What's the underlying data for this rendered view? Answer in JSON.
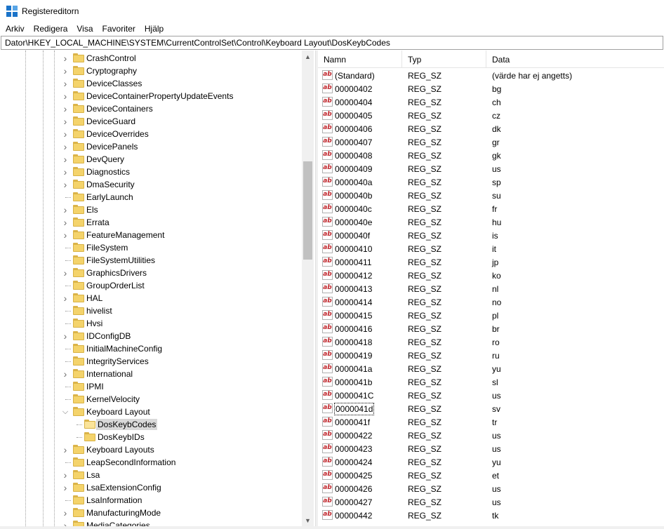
{
  "window": {
    "title": "Registereditorn",
    "app_icon": "registry-editor-icon"
  },
  "menu": [
    "Arkiv",
    "Redigera",
    "Visa",
    "Favoriter",
    "Hjälp"
  ],
  "address": "Dator\\HKEY_LOCAL_MACHINE\\SYSTEM\\CurrentControlSet\\Control\\Keyboard Layout\\DosKeybCodes",
  "tree": {
    "nodes": [
      {
        "label": "CrashControl",
        "expander": "collapsed",
        "level": 0
      },
      {
        "label": "Cryptography",
        "expander": "collapsed",
        "level": 0
      },
      {
        "label": "DeviceClasses",
        "expander": "collapsed",
        "level": 0
      },
      {
        "label": "DeviceContainerPropertyUpdateEvents",
        "expander": "collapsed",
        "level": 0
      },
      {
        "label": "DeviceContainers",
        "expander": "collapsed",
        "level": 0
      },
      {
        "label": "DeviceGuard",
        "expander": "collapsed",
        "level": 0
      },
      {
        "label": "DeviceOverrides",
        "expander": "collapsed",
        "level": 0
      },
      {
        "label": "DevicePanels",
        "expander": "collapsed",
        "level": 0
      },
      {
        "label": "DevQuery",
        "expander": "collapsed",
        "level": 0
      },
      {
        "label": "Diagnostics",
        "expander": "collapsed",
        "level": 0
      },
      {
        "label": "DmaSecurity",
        "expander": "collapsed",
        "level": 0
      },
      {
        "label": "EarlyLaunch",
        "expander": "none",
        "level": 0
      },
      {
        "label": "Els",
        "expander": "collapsed",
        "level": 0
      },
      {
        "label": "Errata",
        "expander": "collapsed",
        "level": 0
      },
      {
        "label": "FeatureManagement",
        "expander": "collapsed",
        "level": 0
      },
      {
        "label": "FileSystem",
        "expander": "none",
        "level": 0
      },
      {
        "label": "FileSystemUtilities",
        "expander": "none",
        "level": 0
      },
      {
        "label": "GraphicsDrivers",
        "expander": "collapsed",
        "level": 0
      },
      {
        "label": "GroupOrderList",
        "expander": "none",
        "level": 0
      },
      {
        "label": "HAL",
        "expander": "collapsed",
        "level": 0
      },
      {
        "label": "hivelist",
        "expander": "none",
        "level": 0
      },
      {
        "label": "Hvsi",
        "expander": "none",
        "level": 0
      },
      {
        "label": "IDConfigDB",
        "expander": "collapsed",
        "level": 0
      },
      {
        "label": "InitialMachineConfig",
        "expander": "none",
        "level": 0
      },
      {
        "label": "IntegrityServices",
        "expander": "none",
        "level": 0
      },
      {
        "label": "International",
        "expander": "collapsed",
        "level": 0
      },
      {
        "label": "IPMI",
        "expander": "none",
        "level": 0
      },
      {
        "label": "KernelVelocity",
        "expander": "none",
        "level": 0
      },
      {
        "label": "Keyboard Layout",
        "expander": "expanded",
        "level": 0
      },
      {
        "label": "DosKeybCodes",
        "expander": "none",
        "level": 1,
        "selected": true
      },
      {
        "label": "DosKeybIDs",
        "expander": "none",
        "level": 1
      },
      {
        "label": "Keyboard Layouts",
        "expander": "collapsed",
        "level": 0
      },
      {
        "label": "LeapSecondInformation",
        "expander": "none",
        "level": 0
      },
      {
        "label": "Lsa",
        "expander": "collapsed",
        "level": 0
      },
      {
        "label": "LsaExtensionConfig",
        "expander": "collapsed",
        "level": 0
      },
      {
        "label": "LsaInformation",
        "expander": "none",
        "level": 0
      },
      {
        "label": "ManufacturingMode",
        "expander": "collapsed",
        "level": 0
      },
      {
        "label": "MediaCategories",
        "expander": "collapsed",
        "level": 0
      }
    ]
  },
  "list": {
    "columns": [
      "Namn",
      "Typ",
      "Data"
    ],
    "rows": [
      {
        "name": "(Standard)",
        "type": "REG_SZ",
        "data": "(värde har ej angetts)"
      },
      {
        "name": "00000402",
        "type": "REG_SZ",
        "data": "bg"
      },
      {
        "name": "00000404",
        "type": "REG_SZ",
        "data": "ch"
      },
      {
        "name": "00000405",
        "type": "REG_SZ",
        "data": "cz"
      },
      {
        "name": "00000406",
        "type": "REG_SZ",
        "data": "dk"
      },
      {
        "name": "00000407",
        "type": "REG_SZ",
        "data": "gr"
      },
      {
        "name": "00000408",
        "type": "REG_SZ",
        "data": "gk"
      },
      {
        "name": "00000409",
        "type": "REG_SZ",
        "data": "us"
      },
      {
        "name": "0000040a",
        "type": "REG_SZ",
        "data": "sp"
      },
      {
        "name": "0000040b",
        "type": "REG_SZ",
        "data": "su"
      },
      {
        "name": "0000040c",
        "type": "REG_SZ",
        "data": "fr"
      },
      {
        "name": "0000040e",
        "type": "REG_SZ",
        "data": "hu"
      },
      {
        "name": "0000040f",
        "type": "REG_SZ",
        "data": "is"
      },
      {
        "name": "00000410",
        "type": "REG_SZ",
        "data": "it"
      },
      {
        "name": "00000411",
        "type": "REG_SZ",
        "data": "jp"
      },
      {
        "name": "00000412",
        "type": "REG_SZ",
        "data": "ko"
      },
      {
        "name": "00000413",
        "type": "REG_SZ",
        "data": "nl"
      },
      {
        "name": "00000414",
        "type": "REG_SZ",
        "data": "no"
      },
      {
        "name": "00000415",
        "type": "REG_SZ",
        "data": "pl"
      },
      {
        "name": "00000416",
        "type": "REG_SZ",
        "data": "br"
      },
      {
        "name": "00000418",
        "type": "REG_SZ",
        "data": "ro"
      },
      {
        "name": "00000419",
        "type": "REG_SZ",
        "data": "ru"
      },
      {
        "name": "0000041a",
        "type": "REG_SZ",
        "data": "yu"
      },
      {
        "name": "0000041b",
        "type": "REG_SZ",
        "data": "sl"
      },
      {
        "name": "0000041C",
        "type": "REG_SZ",
        "data": "us"
      },
      {
        "name": "0000041d",
        "type": "REG_SZ",
        "data": "sv",
        "focused": true
      },
      {
        "name": "0000041f",
        "type": "REG_SZ",
        "data": "tr"
      },
      {
        "name": "00000422",
        "type": "REG_SZ",
        "data": "us"
      },
      {
        "name": "00000423",
        "type": "REG_SZ",
        "data": "us"
      },
      {
        "name": "00000424",
        "type": "REG_SZ",
        "data": "yu"
      },
      {
        "name": "00000425",
        "type": "REG_SZ",
        "data": "et"
      },
      {
        "name": "00000426",
        "type": "REG_SZ",
        "data": "us"
      },
      {
        "name": "00000427",
        "type": "REG_SZ",
        "data": "us"
      },
      {
        "name": "00000442",
        "type": "REG_SZ",
        "data": "tk"
      }
    ],
    "value_icon": "string-value-icon",
    "value_icon_text": "ab"
  },
  "colors": {
    "folder": "#f4d36b",
    "selection": "#d9d9d9",
    "value_icon_red": "#c1272d"
  }
}
